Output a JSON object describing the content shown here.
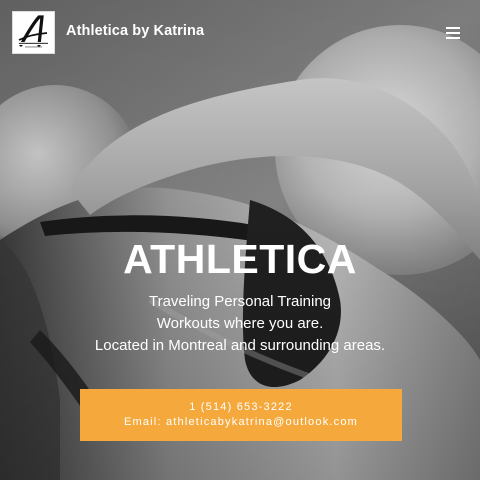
{
  "header": {
    "brand": "Athletica by Katrina",
    "logo": {
      "letter": "A",
      "caption": "ATHLETICA by Katrina"
    },
    "menu_icon": "hamburger-menu-icon"
  },
  "hero": {
    "title": "ATHLETICA",
    "lines": [
      "Traveling Personal Training",
      "Workouts where you are.",
      "Located in Montreal and surrounding areas."
    ],
    "cta": {
      "phone": "1 (514) 653-3222",
      "email": "Email: athleticabykatrina@outlook.com"
    }
  },
  "colors": {
    "cta": "#f5a93c",
    "text": "#ffffff"
  }
}
